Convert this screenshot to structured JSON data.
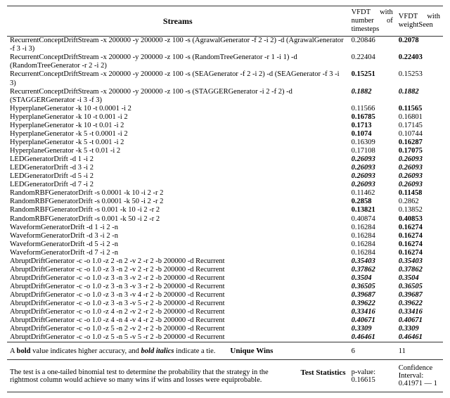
{
  "headers": {
    "streams": "Streams",
    "col1": "VFDT with num­ber of timesteps",
    "col2": "VFDT with weight­Seen"
  },
  "rows": [
    {
      "s": "RecurrentConceptDriftStream -x 200000 -y 200000 -z 100 -s (AgrawalGenerator -f 2 -i 2) -d (AgrawalGenerator -f 3 -i 3)",
      "v1": "0.20846",
      "v2": "0.2078",
      "f1": "",
      "f2": "b"
    },
    {
      "s": "RecurrentConceptDriftStream -x 200000 -y 200000 -z 100 -s (RandomTreeGenerator -r 1 -i 1) -d (RandomTreeGenerator -r 2 -i 2)",
      "v1": "0.22404",
      "v2": "0.22403",
      "f1": "",
      "f2": "b"
    },
    {
      "s": "RecurrentConceptDriftStream -x 200000 -y 200000 -z 100 -s (SEAGenerator -f 2 -i 2) -d (SEAGen­erator -f 3 -i 3)",
      "v1": "0.15251",
      "v2": "0.15253",
      "f1": "b",
      "f2": ""
    },
    {
      "s": "RecurrentConceptDriftStream -x 200000 -y 200000 -z 100 -s (STAGGERGenerator -i 2 -f 2) -d (STAGGERGenerator -i 3 -f 3)",
      "v1": "0.1882",
      "v2": "0.1882",
      "f1": "bi",
      "f2": "bi"
    },
    {
      "s": "HyperplaneGenerator -k 10 -t 0.0001 -i 2",
      "v1": "0.11566",
      "v2": "0.11565",
      "f1": "",
      "f2": "b"
    },
    {
      "s": "HyperplaneGenerator -k 10 -t 0.001 -i 2",
      "v1": "0.16785",
      "v2": "0.16801",
      "f1": "b",
      "f2": ""
    },
    {
      "s": "HyperplaneGenerator -k 10 -t 0.01 -i 2",
      "v1": "0.1713",
      "v2": "0.17145",
      "f1": "b",
      "f2": ""
    },
    {
      "s": "HyperplaneGenerator -k 5 -t 0.0001 -i 2",
      "v1": "0.1074",
      "v2": "0.10744",
      "f1": "b",
      "f2": ""
    },
    {
      "s": "HyperplaneGenerator -k 5 -t 0.001 -i 2",
      "v1": "0.16309",
      "v2": "0.16287",
      "f1": "",
      "f2": "b"
    },
    {
      "s": "HyperplaneGenerator -k 5 -t 0.01 -i 2",
      "v1": "0.17108",
      "v2": "0.17075",
      "f1": "",
      "f2": "b"
    },
    {
      "s": "LEDGeneratorDrift -d 1 -i 2",
      "v1": "0.26093",
      "v2": "0.26093",
      "f1": "bi",
      "f2": "bi"
    },
    {
      "s": "LEDGeneratorDrift -d 3 -i 2",
      "v1": "0.26093",
      "v2": "0.26093",
      "f1": "bi",
      "f2": "bi"
    },
    {
      "s": "LEDGeneratorDrift -d 5 -i 2",
      "v1": "0.26093",
      "v2": "0.26093",
      "f1": "bi",
      "f2": "bi"
    },
    {
      "s": "LEDGeneratorDrift -d 7 -i 2",
      "v1": "0.26093",
      "v2": "0.26093",
      "f1": "bi",
      "f2": "bi"
    },
    {
      "s": "RandomRBFGeneratorDrift -s 0.0001 -k 10 -i 2 -r 2",
      "v1": "0.11462",
      "v2": "0.11458",
      "f1": "",
      "f2": "b"
    },
    {
      "s": "RandomRBFGeneratorDrift -s 0.0001 -k 50 -i 2 -r 2",
      "v1": "0.2858",
      "v2": "0.2862",
      "f1": "b",
      "f2": ""
    },
    {
      "s": "RandomRBFGeneratorDrift -s 0.001 -k 10 -i 2 -r 2",
      "v1": "0.13821",
      "v2": "0.13852",
      "f1": "b",
      "f2": ""
    },
    {
      "s": "RandomRBFGeneratorDrift -s 0.001 -k 50 -i 2 -r 2",
      "v1": "0.40874",
      "v2": "0.40853",
      "f1": "",
      "f2": "b"
    },
    {
      "s": "WaveformGeneratorDrift -d 1 -i 2 -n",
      "v1": "0.16284",
      "v2": "0.16274",
      "f1": "",
      "f2": "b"
    },
    {
      "s": "WaveformGeneratorDrift -d 3 -i 2 -n",
      "v1": "0.16284",
      "v2": "0.16274",
      "f1": "",
      "f2": "b"
    },
    {
      "s": "WaveformGeneratorDrift -d 5 -i 2 -n",
      "v1": "0.16284",
      "v2": "0.16274",
      "f1": "",
      "f2": "b"
    },
    {
      "s": "WaveformGeneratorDrift -d 7 -i 2 -n",
      "v1": "0.16284",
      "v2": "0.16274",
      "f1": "",
      "f2": "b"
    },
    {
      "s": "AbruptDriftGenerator -c -o 1.0 -z 2 -n 2 -v 2 -r 2 -b 200000 -d Recurrent",
      "v1": "0.35403",
      "v2": "0.35403",
      "f1": "bi",
      "f2": "bi"
    },
    {
      "s": "AbruptDriftGenerator -c -o 1.0 -z 3 -n 2 -v 2 -r 2 -b 200000 -d Recurrent",
      "v1": "0.37862",
      "v2": "0.37862",
      "f1": "bi",
      "f2": "bi"
    },
    {
      "s": "AbruptDriftGenerator -c -o 1.0 -z 3 -n 3 -v 2 -r 2 -b 200000 -d Recurrent",
      "v1": "0.3504",
      "v2": "0.3504",
      "f1": "bi",
      "f2": "bi"
    },
    {
      "s": "AbruptDriftGenerator -c -o 1.0 -z 3 -n 3 -v 3 -r 2 -b 200000 -d Recurrent",
      "v1": "0.36505",
      "v2": "0.36505",
      "f1": "bi",
      "f2": "bi"
    },
    {
      "s": "AbruptDriftGenerator -c -o 1.0 -z 3 -n 3 -v 4 -r 2 -b 200000 -d Recurrent",
      "v1": "0.39687",
      "v2": "0.39687",
      "f1": "bi",
      "f2": "bi"
    },
    {
      "s": "AbruptDriftGenerator -c -o 1.0 -z 3 -n 3 -v 5 -r 2 -b 200000 -d Recurrent",
      "v1": "0.39622",
      "v2": "0.39622",
      "f1": "bi",
      "f2": "bi"
    },
    {
      "s": "AbruptDriftGenerator -c -o 1.0 -z 4 -n 2 -v 2 -r 2 -b 200000 -d Recurrent",
      "v1": "0.33416",
      "v2": "0.33416",
      "f1": "bi",
      "f2": "bi"
    },
    {
      "s": "AbruptDriftGenerator -c -o 1.0 -z 4 -n 4 -v 4 -r 2 -b 200000 -d Recurrent",
      "v1": "0.40671",
      "v2": "0.40671",
      "f1": "bi",
      "f2": "bi"
    },
    {
      "s": "AbruptDriftGenerator -c -o 1.0 -z 5 -n 2 -v 2 -r 2 -b 200000 -d Recurrent",
      "v1": "0.3309",
      "v2": "0.3309",
      "f1": "bi",
      "f2": "bi"
    },
    {
      "s": "AbruptDriftGenerator -c -o 1.0 -z 5 -n 5 -v 5 -r 2 -b 200000 -d Recurrent",
      "v1": "0.46461",
      "v2": "0.46461",
      "f1": "bi",
      "f2": "bi"
    }
  ],
  "footer1": {
    "note": "A bold value indicates higher accuracy, and bold italics indicate a tie.",
    "note_bold1": "bold",
    "note_bold2": "bold italics",
    "label": "Unique Wins",
    "v1": "6",
    "v2": "11"
  },
  "footer2": {
    "note": "The test is a one-tailed binomial test to determine the probability that the strategy in the rightmost column would achieve so many wins if wins and losses were equiprobable.",
    "label": "Test Statistics",
    "v1": "p-value: 0.16615",
    "v2": "Confi­dence Interval: 0.41971 — 1"
  }
}
